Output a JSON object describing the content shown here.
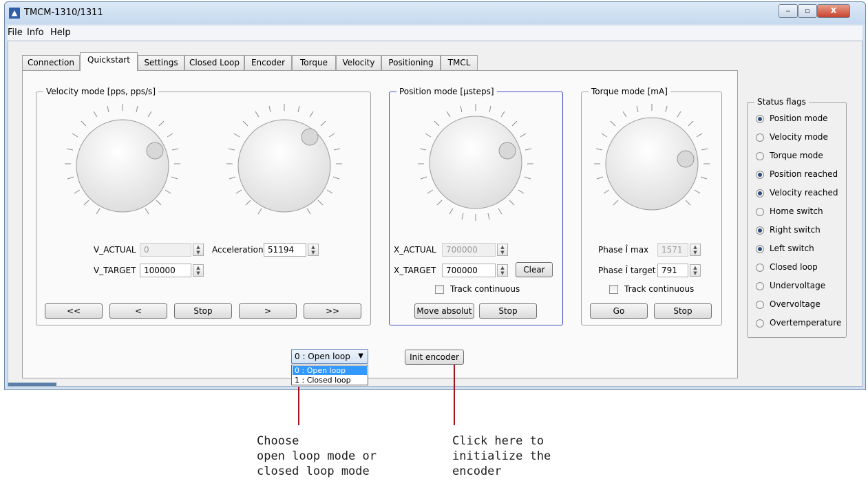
{
  "window": {
    "title": "TMCM-1310/1311",
    "minimize": "‒",
    "maximize": "▫",
    "close": "X"
  },
  "menu": [
    "File",
    "Info",
    "Help"
  ],
  "tabs": [
    "Connection",
    "Quickstart",
    "Settings",
    "Closed Loop",
    "Encoder",
    "Torque",
    "Velocity",
    "Positioning",
    "TMCL"
  ],
  "active_tab": "Quickstart",
  "velocity": {
    "title": "Velocity mode [pps, pps/s]",
    "v_actual_label": "V_ACTUAL",
    "v_actual": "0",
    "accel_label": "Acceleration",
    "accel": "51194",
    "v_target_label": "V_TARGET",
    "v_target": "100000",
    "buttons": [
      "<<",
      "<",
      "Stop",
      ">",
      ">>"
    ]
  },
  "position": {
    "title": "Position mode [µsteps]",
    "x_actual_label": "X_ACTUAL",
    "x_actual": "700000",
    "x_target_label": "X_TARGET",
    "x_target": "700000",
    "clear": "Clear",
    "track": "Track continuous",
    "move": "Move absolut",
    "stop": "Stop"
  },
  "torque": {
    "title": "Torque mode [mA]",
    "max_label": "Phase Î max",
    "max": "1571",
    "target_label": "Phase Î target",
    "target": "791",
    "track": "Track continuous",
    "go": "Go",
    "stop": "Stop"
  },
  "status": {
    "title": "Status flags",
    "flags": [
      {
        "label": "Position mode",
        "on": true
      },
      {
        "label": "Velocity mode",
        "on": false
      },
      {
        "label": "Torque mode",
        "on": false
      },
      {
        "label": "Position reached",
        "on": true
      },
      {
        "label": "Velocity reached",
        "on": true
      },
      {
        "label": "Home switch",
        "on": false
      },
      {
        "label": "Right switch",
        "on": true
      },
      {
        "label": "Left switch",
        "on": true
      },
      {
        "label": "Closed loop",
        "on": false
      },
      {
        "label": "Undervoltage",
        "on": false
      },
      {
        "label": "Overvoltage",
        "on": false
      },
      {
        "label": "Overtemperature",
        "on": false
      }
    ]
  },
  "loop_mode": {
    "selected": "0 : Open loop",
    "options": [
      "0 : Open loop",
      "1 : Closed loop"
    ]
  },
  "init_encoder": "Init encoder",
  "annotations": {
    "left": [
      "Choose",
      "open loop mode or",
      "closed loop mode"
    ],
    "right": [
      "Click here to",
      "initialize the",
      "encoder"
    ]
  },
  "colors": {
    "focus_border": "#3e4fc4",
    "annotation_line": "#a0141c",
    "selected_option": "#3399ff"
  }
}
